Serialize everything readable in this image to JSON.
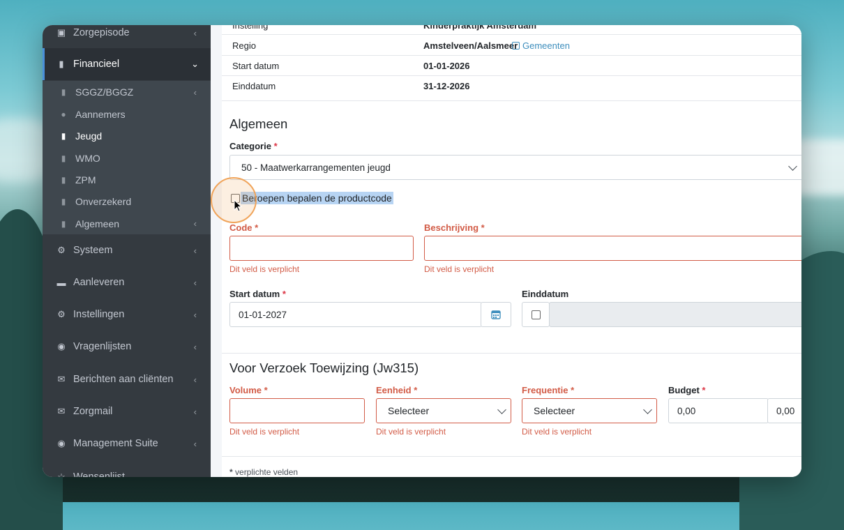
{
  "sidebar": {
    "items": [
      {
        "label": "Zorgepisode",
        "icon": "medkit-icon"
      },
      {
        "label": "Financieel",
        "icon": "book-icon"
      },
      {
        "label": "Systeem",
        "icon": "cogs-icon"
      },
      {
        "label": "Aanleveren",
        "icon": "truck-icon"
      },
      {
        "label": "Instellingen",
        "icon": "gear-icon"
      },
      {
        "label": "Vragenlijsten",
        "icon": "globe-icon"
      },
      {
        "label": "Berichten aan cliënten",
        "icon": "envelope-icon"
      },
      {
        "label": "Zorgmail",
        "icon": "envelope-icon"
      },
      {
        "label": "Management Suite",
        "icon": "globe-icon"
      },
      {
        "label": "Wensenlijst",
        "icon": "star-icon"
      }
    ],
    "financieel_sub": [
      {
        "label": "SGGZ/BGGZ",
        "icon": "book-icon"
      },
      {
        "label": "Aannemers",
        "icon": "users-icon"
      },
      {
        "label": "Jeugd",
        "icon": "book-icon"
      },
      {
        "label": "WMO",
        "icon": "book-icon"
      },
      {
        "label": "ZPM",
        "icon": "book-icon"
      },
      {
        "label": "Onverzekerd",
        "icon": "book-icon"
      },
      {
        "label": "Algemeen",
        "icon": "book-icon"
      }
    ]
  },
  "info": {
    "instelling_label": "Instelling",
    "instelling_value": "Kinderpraktijk Amsterdam",
    "regio_label": "Regio",
    "regio_value": "Amstelveen/Aalsmeer",
    "gemeenten_link": "Gemeenten",
    "start_label": "Start datum",
    "start_value": "01-01-2026",
    "eind_label": "Einddatum",
    "eind_value": "31-12-2026"
  },
  "algemeen": {
    "title": "Algemeen",
    "categorie_label": "Categorie",
    "categorie_value": "50 - Maatwerkarrangementen jeugd",
    "beroepen_label": "Beroepen bepalen de productcode",
    "code_label": "Code",
    "beschrijving_label": "Beschrijving",
    "required_error": "Dit veld is verplicht",
    "start_label": "Start datum",
    "start_value": "01-01-2027",
    "eind_label": "Einddatum",
    "required_mark": "*"
  },
  "jw315": {
    "title": "Voor Verzoek Toewijzing (Jw315)",
    "volume_label": "Volume",
    "eenheid_label": "Eenheid",
    "eenheid_value": "Selecteer",
    "frequentie_label": "Frequentie",
    "frequentie_value": "Selecteer",
    "budget_label": "Budget",
    "budget_value": "0,00",
    "budget_value2": "0,00"
  },
  "footer_note": "verplichte velden",
  "colors": {
    "accent": "#3c8dbc",
    "error": "#d25b46",
    "sidebar": "#343a40"
  }
}
